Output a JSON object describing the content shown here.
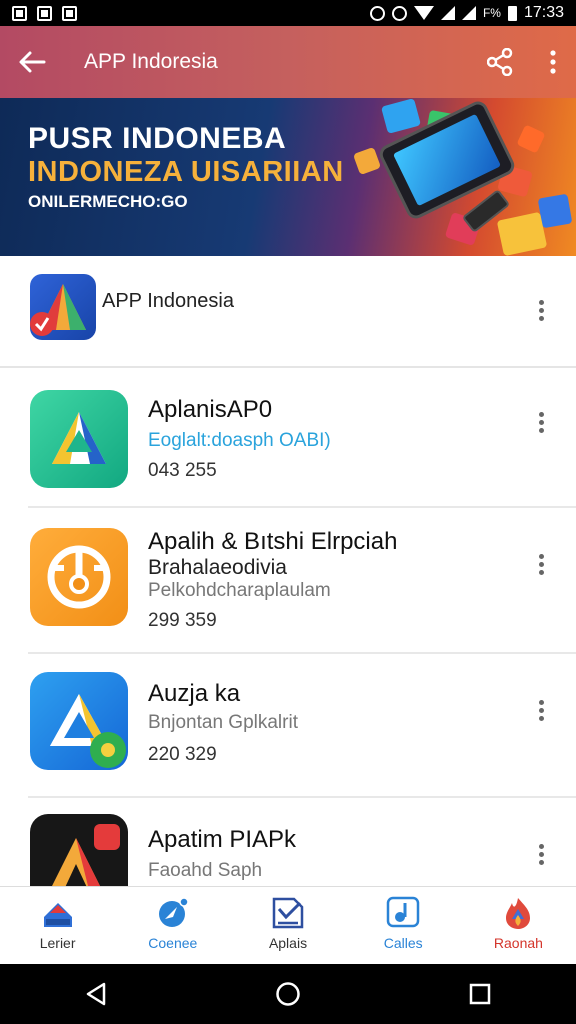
{
  "status_bar": {
    "battery_text": "F%",
    "time": "17:33",
    "icons": [
      "notification-icon",
      "notification-icon",
      "notification-icon",
      "alarm-icon",
      "alarm-icon",
      "wifi-icon",
      "signal-icon",
      "signal-icon",
      "battery-icon"
    ]
  },
  "app_bar": {
    "title": "APP Indoresia",
    "back_icon": "arrow-left-icon",
    "share_icon": "share-icon",
    "more_icon": "more-vert-icon"
  },
  "banner": {
    "line1": "PUSR INDONEBA",
    "line2": "INDONEZA UISARIIAN",
    "line3": "ONILERMECHO:GO",
    "colors": {
      "headline": "#ffffff",
      "accent": "#f6b13b"
    }
  },
  "app_header": {
    "name": "APP Indonesia"
  },
  "apps": [
    {
      "name": "AplanisAP0",
      "sub": "Eoglalt:doasph OABI)",
      "number": "043 255"
    },
    {
      "name": "Apalih & Bıtshi Elrpciah",
      "sub": "Brahalaeodivia",
      "sub2": "Pelkohdcharaplaulam",
      "number": "299 359"
    },
    {
      "name": "Auzja ka",
      "sub": "Bnjontan Gplkalrit",
      "number": "220 329"
    },
    {
      "name": "Apatim PIAPk",
      "sub": "Faoahd Saph"
    }
  ],
  "bottom_nav": [
    {
      "label": "Lerier",
      "color": "#333333"
    },
    {
      "label": "Coenee",
      "color": "#2a83d6"
    },
    {
      "label": "Aplais",
      "color": "#333333"
    },
    {
      "label": "Calles",
      "color": "#2a83d6"
    },
    {
      "label": "Raonah",
      "color": "#d4352b"
    }
  ],
  "colors": {
    "app_bar_start": "#b34a63",
    "app_bar_end": "#df6a48",
    "link_blue": "#2aa3dc"
  }
}
